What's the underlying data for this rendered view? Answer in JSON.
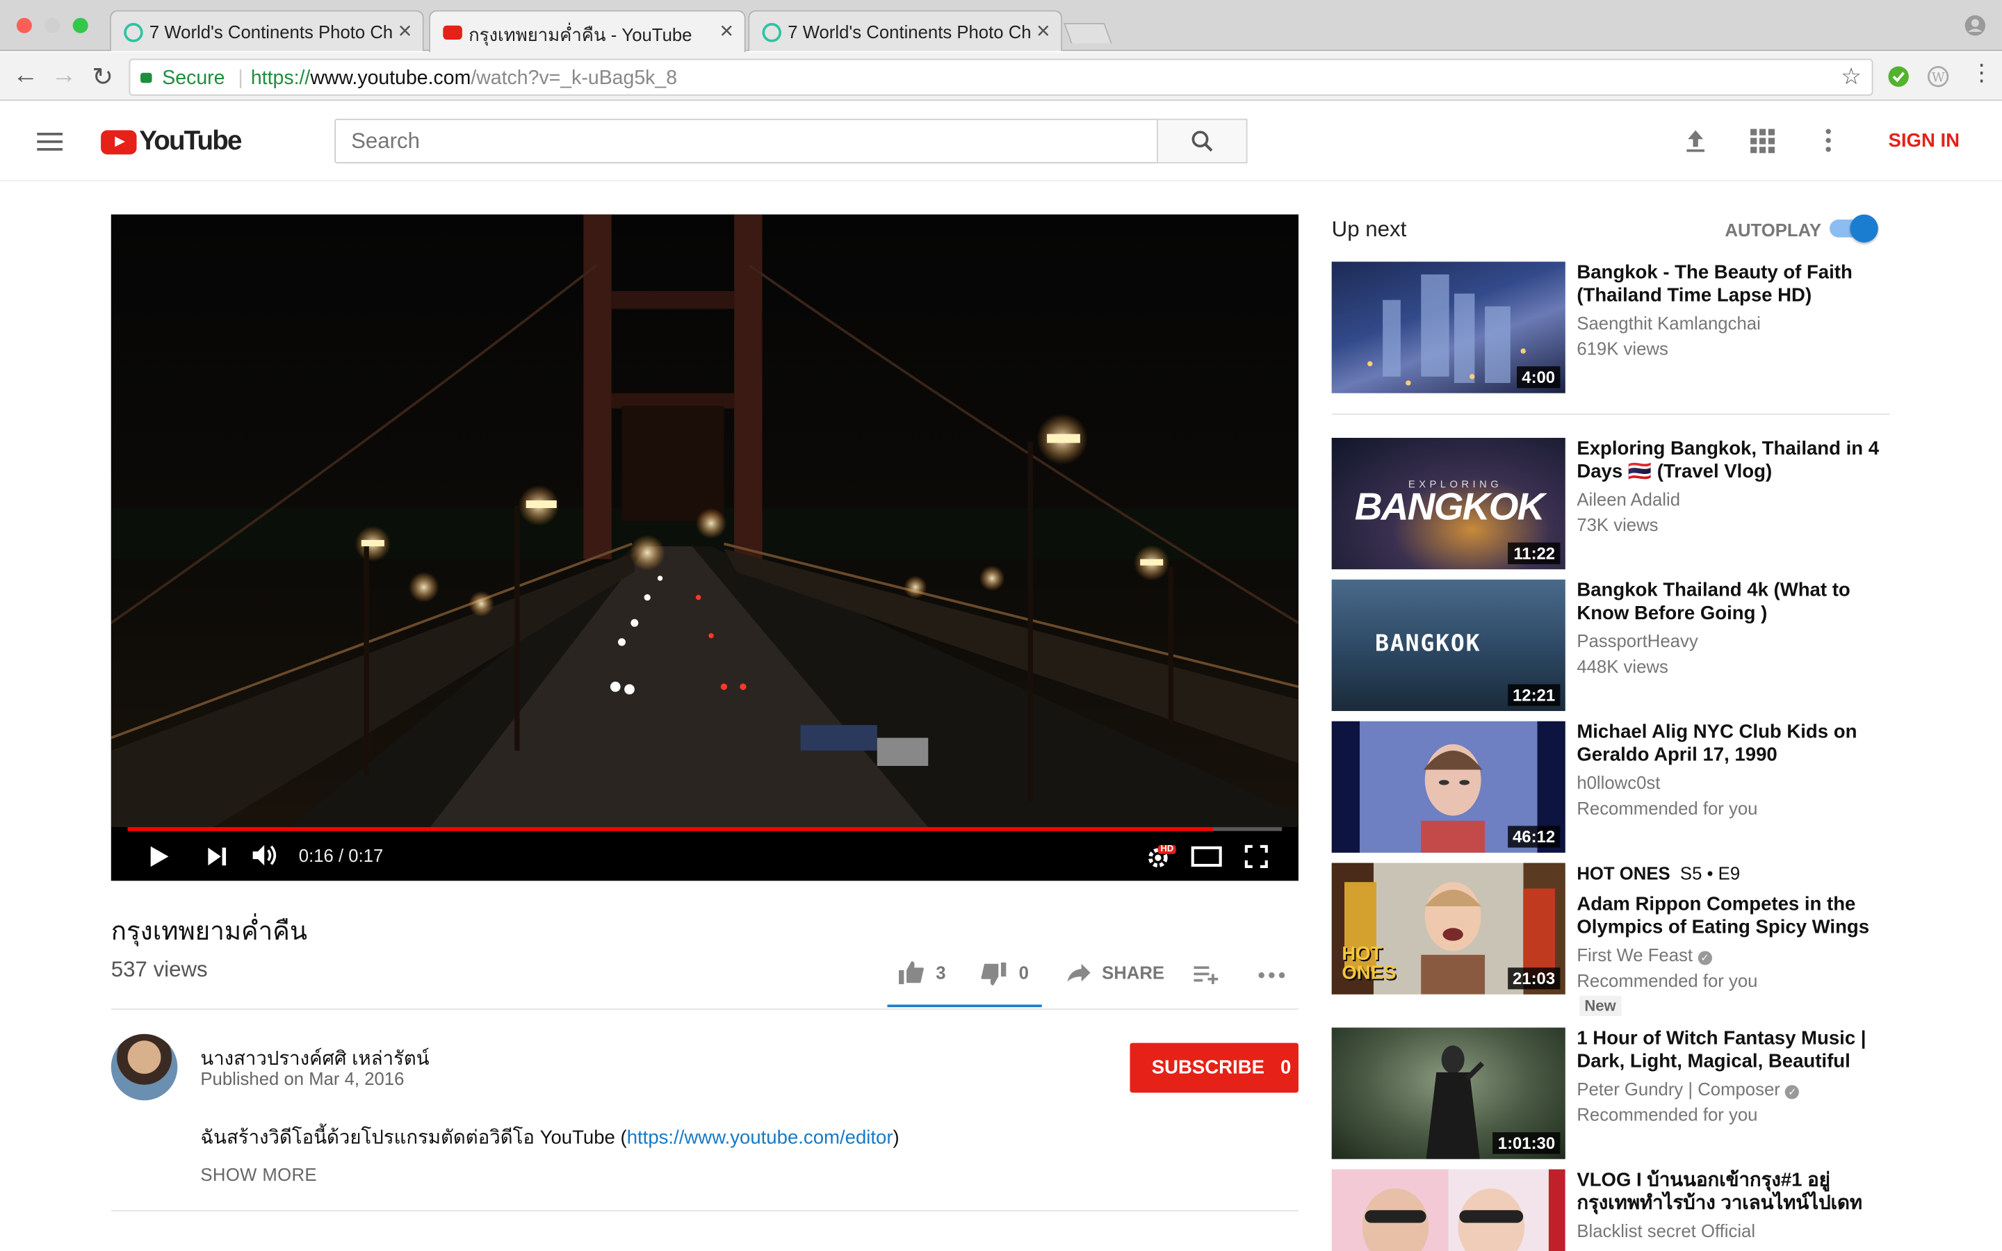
{
  "browser": {
    "tabs": [
      {
        "title": "7 World's Continents Photo Ch",
        "active": false
      },
      {
        "title": "กรุงเทพยามค่ำคืน - YouTube",
        "active": true
      },
      {
        "title": "7 World's Continents Photo Ch",
        "active": false
      }
    ],
    "secure_label": "Secure",
    "url_scheme": "https://",
    "url_host": "www.youtube.com",
    "url_path": "/watch?v=_k-uBag5k_8"
  },
  "header": {
    "logo_text": "YouTube",
    "search_placeholder": "Search",
    "signin_label": "SIGN IN"
  },
  "player": {
    "progress": 0.94,
    "time": "0:16 / 0:17",
    "hd_badge": "HD"
  },
  "video": {
    "title": "กรุงเทพยามค่ำคืน",
    "views": "537 views",
    "likes": "3",
    "dislikes": "0",
    "share_label": "SHARE"
  },
  "channel": {
    "name": "นางสาวปรางค์ศศิ เหล่ารัตน์",
    "published": "Published on Mar 4, 2016",
    "subscribe_label": "SUBSCRIBE",
    "subscriber_count": "0"
  },
  "description": {
    "text": "ฉันสร้างวิดีโอนี้ด้วยโปรแกรมตัดต่อวิดีโอ YouTube (",
    "link": "https://www.youtube.com/editor",
    "text_end": ")",
    "show_more": "SHOW MORE"
  },
  "sidebar": {
    "up_next_label": "Up next",
    "autoplay_label": "AUTOPLAY",
    "autoplay_on": true,
    "videos": [
      {
        "title": "Bangkok - The Beauty of Faith (Thailand Time Lapse HD)",
        "channel": "Saengthit Kamlangchai",
        "meta": "619K views",
        "duration": "4:00"
      },
      {
        "title": "Exploring Bangkok, Thailand in 4 Days 🇹🇭 (Travel Vlog)",
        "channel": "Aileen Adalid",
        "meta": "73K views",
        "duration": "11:22",
        "thumb_text": "BANGKOK",
        "thumb_subtext": "EXPLORING"
      },
      {
        "title": "Bangkok Thailand 4k (What to Know Before Going )",
        "channel": "PassportHeavy",
        "meta": "448K views",
        "duration": "12:21",
        "thumb_text": "BANGKOK"
      },
      {
        "title": "Michael Alig NYC Club Kids on Geraldo April 17, 1990",
        "channel": "h0llowc0st",
        "meta": "Recommended for you",
        "duration": "46:12"
      },
      {
        "series": "HOT ONES",
        "series_ep": "S5 • E9",
        "title": "Adam Rippon Competes in the Olympics of Eating Spicy Wings",
        "channel": "First We Feast",
        "meta": "Recommended for you",
        "badge": "New",
        "duration": "21:03",
        "thumb_text": "HOT ONES"
      },
      {
        "title": "1 Hour of Witch Fantasy Music | Dark, Light, Magical, Beautiful",
        "channel": "Peter Gundry | Composer",
        "meta": "Recommended for you",
        "duration": "1:01:30"
      },
      {
        "title": "VLOG I บ้านนอกเข้ากรุง#1 อยู่กรุงเทพทำไรบ้าง วาเลนไทน์ไปเดท",
        "channel": "Blacklist secret Official"
      }
    ]
  }
}
